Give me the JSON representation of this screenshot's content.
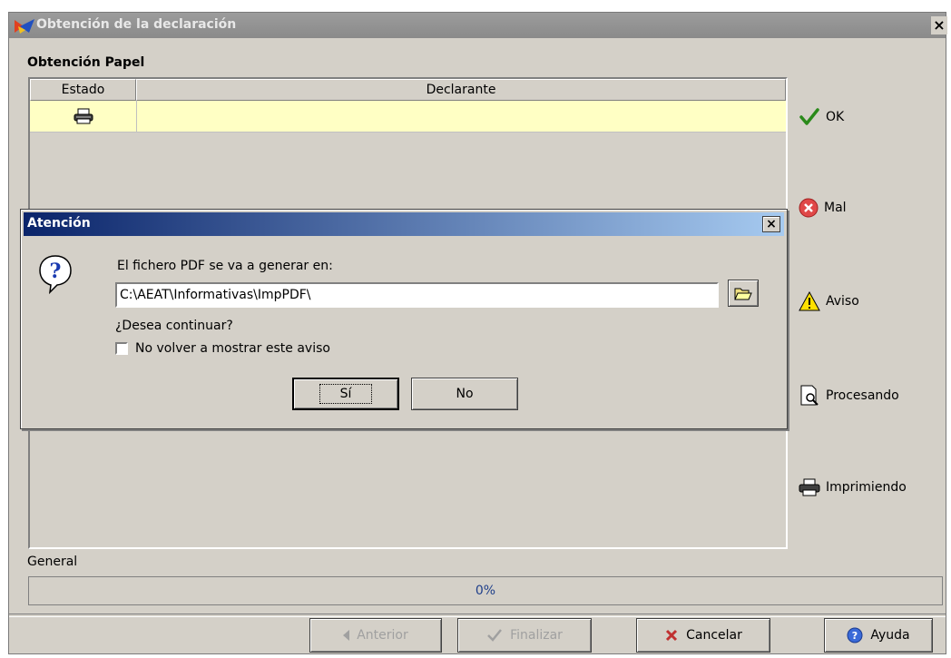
{
  "window": {
    "title": "Obtención de la declaración",
    "close": "×"
  },
  "panel": {
    "section_label": "Obtención Papel",
    "columns": [
      "Estado",
      "Declarante"
    ],
    "rows": [
      {
        "estado_icon": "printer-icon",
        "declarante": ""
      }
    ]
  },
  "legend": [
    {
      "icon": "check-icon",
      "label": "OK"
    },
    {
      "icon": "error-icon",
      "label": "Mal"
    },
    {
      "icon": "warning-icon",
      "label": "Aviso"
    },
    {
      "icon": "magnifier-doc-icon",
      "label": "Procesando"
    },
    {
      "icon": "printer-icon",
      "label": "Imprimiendo"
    }
  ],
  "progress": {
    "label": "General",
    "text": "0%",
    "value": 0
  },
  "buttons": {
    "anterior": "Anterior",
    "finalizar": "Finalizar",
    "cancelar": "Cancelar",
    "ayuda": "Ayuda"
  },
  "dialog": {
    "title": "Atención",
    "close": "×",
    "message": "El fichero PDF se va a generar en:",
    "path": "C:\\AEAT\\Informativas\\ImpPDF\\",
    "question": "¿Desea continuar?",
    "checkbox_label": "No volver a mostrar este aviso",
    "checkbox_checked": false,
    "yes": "Sí",
    "no": "No"
  },
  "colors": {
    "row_highlight": "#ffffc4",
    "dialog_title": "#0a246a",
    "progress_text": "#1f3f8a"
  }
}
